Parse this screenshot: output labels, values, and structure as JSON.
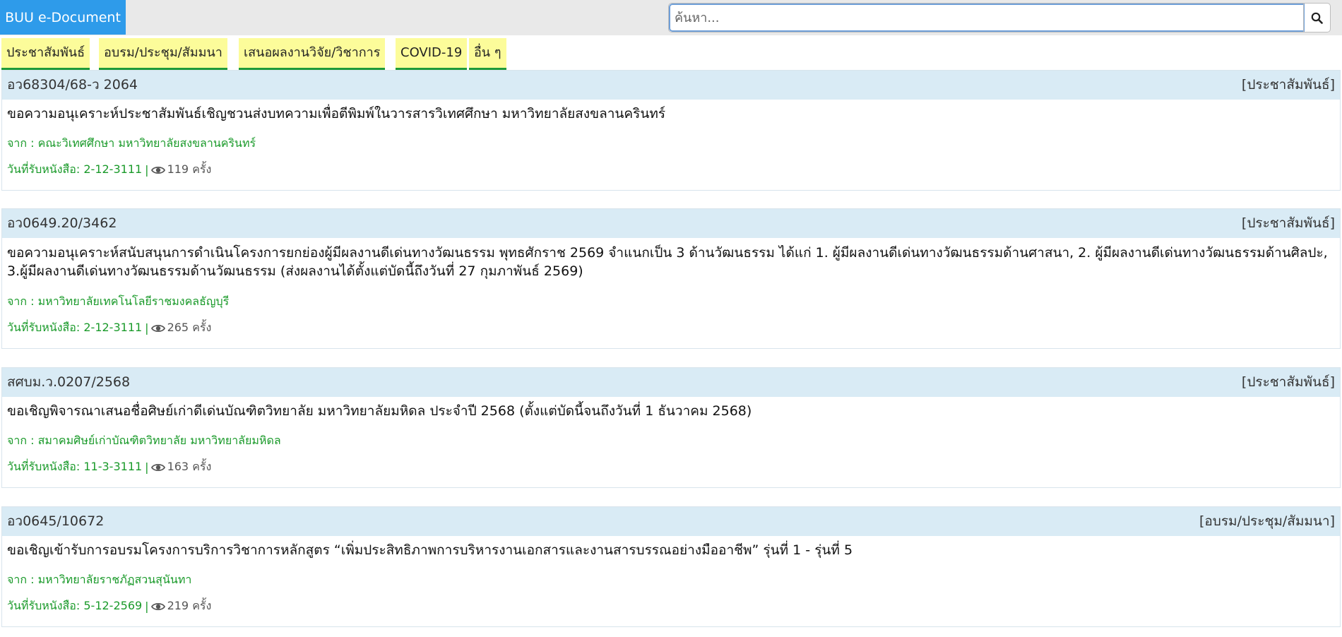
{
  "app": {
    "brand": "BUU e-Document"
  },
  "search": {
    "placeholder": "ค้นหา...",
    "value": ""
  },
  "tabs": [
    {
      "label": "ประชาสัมพันธ์"
    },
    {
      "label": "อบรม/ประชุม/สัมมนา"
    },
    {
      "label": "เสนอผลงานวิจัย/วิชาการ"
    },
    {
      "label": "COVID-19"
    },
    {
      "label": "อื่น ๆ"
    }
  ],
  "documents": [
    {
      "number": "อว68304/68-ว 2064",
      "category": "[ประชาสัมพันธ์]",
      "title": "ขอความอนุเคราะห์ประชาสัมพันธ์เชิญชวนส่งบทความเพื่อตีพิมพ์ในวารสารวิเทศศึกษา มหาวิทยาลัยสงขลานครินทร์",
      "from": "จาก : คณะวิเทศศึกษา มหาวิทยาลัยสงขลานครินทร์",
      "received": "วันที่รับหนังสือ: 2-12-3111",
      "separator": "|",
      "views": "119 ครั้ง"
    },
    {
      "number": "อว0649.20/3462",
      "category": "[ประชาสัมพันธ์]",
      "title": "ขอความอนุเคราะห์สนับสนุนการดำเนินโครงการยกย่องผู้มีผลงานดีเด่นทางวัฒนธรรม พุทธศักราช 2569 จำแนกเป็น 3 ด้านวัฒนธรรม ได้แก่ 1. ผู้มีผลงานดีเด่นทางวัฒนธรรมด้านศาสนา, 2. ผู้มีผลงานดีเด่นทางวัฒนธรรมด้านศิลปะ, 3.ผู้มีผลงานดีเด่นทางวัฒนธรรมด้านวัฒนธรรม (ส่งผลงานได้ตั้งแต่บัดนี้ถึงวันที่ 27 กุมภาพันธ์ 2569)",
      "from": "จาก : มหาวิทยาลัยเทคโนโลยีราชมงคลธัญบุรี",
      "received": "วันที่รับหนังสือ: 2-12-3111",
      "separator": "|",
      "views": "265 ครั้ง"
    },
    {
      "number": "สศบม.ว.0207/2568",
      "category": "[ประชาสัมพันธ์]",
      "title": "ขอเชิญพิจารณาเสนอชื่อศิษย์เก่าดีเด่นบัณฑิตวิทยาลัย มหาวิทยาลัยมหิดล ประจำปี 2568 (ตั้งแต่บัดนี้จนถึงวันที่ 1 ธันวาคม 2568)",
      "from": "จาก : สมาคมศิษย์เก่าบัณฑิตวิทยาลัย มหาวิทยาลัยมหิดล",
      "received": "วันที่รับหนังสือ: 11-3-3111",
      "separator": "|",
      "views": "163 ครั้ง"
    },
    {
      "number": "อว0645/10672",
      "category": "[อบรม/ประชุม/สัมมนา]",
      "title": "ขอเชิญเข้ารับการอบรมโครงการบริการวิชาการหลักสูตร “เพิ่มประสิทธิภาพการบริหารงานเอกสารและงานสารบรรณอย่างมืออาชีพ” รุ่นที่ 1 - รุ่นที่ 5",
      "from": "จาก : มหาวิทยาลัยราชภัฏสวนสุนันทา",
      "received": "วันที่รับหนังสือ: 5-12-2569",
      "separator": "|",
      "views": "219 ครั้ง"
    }
  ],
  "icons": {
    "search": "search-icon",
    "views": "eye-icon"
  },
  "colors": {
    "brand": "#2e9bea",
    "tab_bg": "#fcfc9a",
    "tab_underline": "#1f9a3a",
    "doc_header_bg": "#d9ebf5",
    "meta_text": "#1a9a2a"
  }
}
